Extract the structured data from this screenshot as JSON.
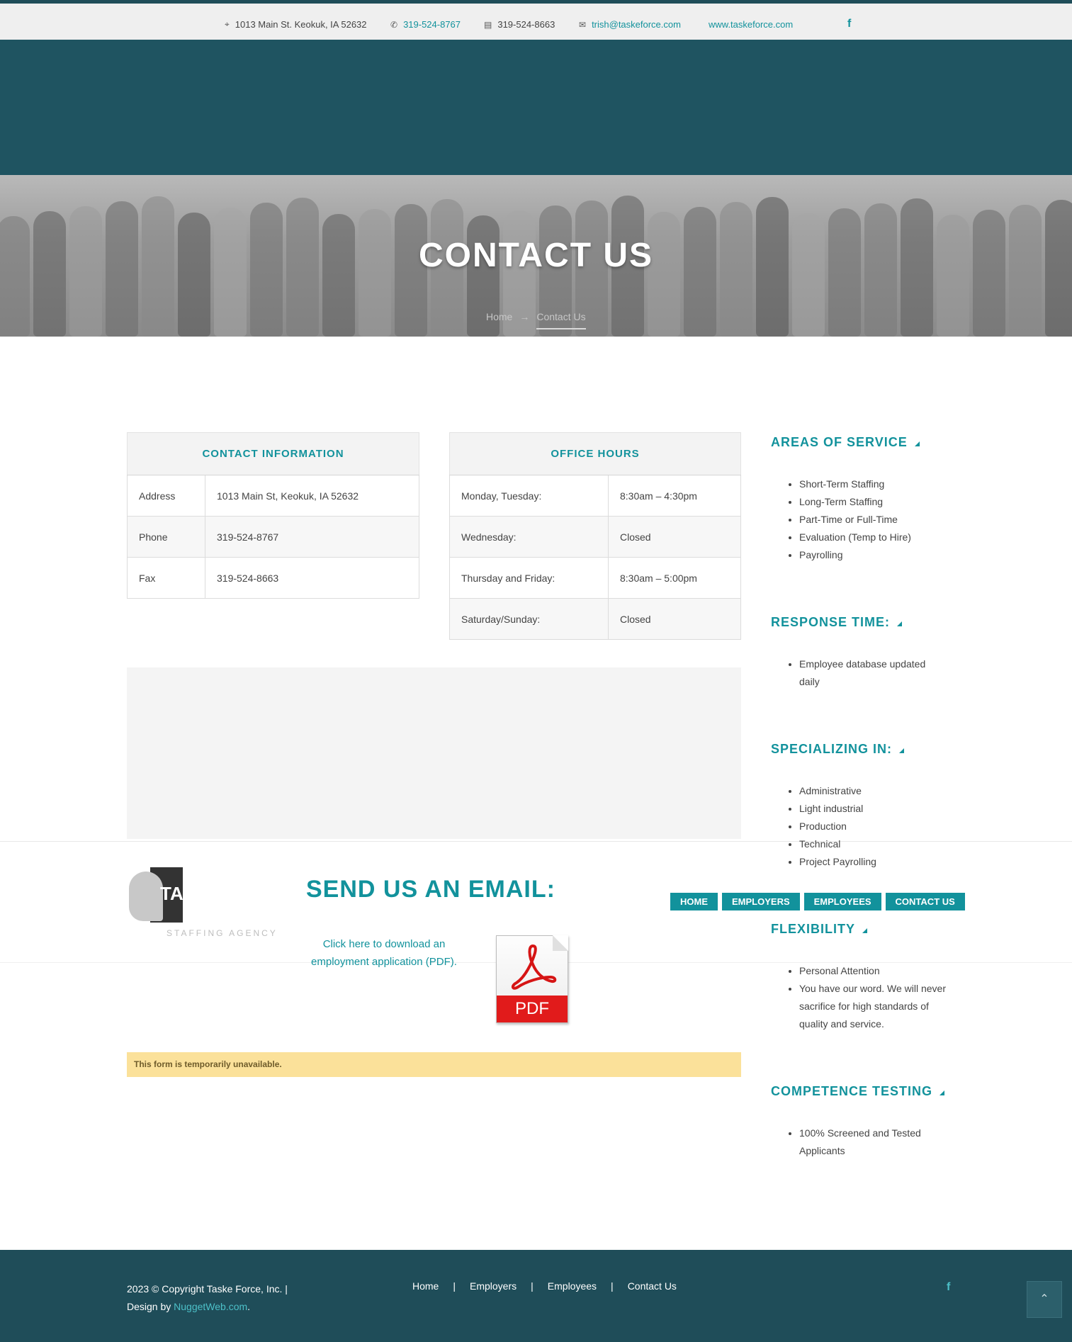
{
  "topbar": {
    "address": "1013 Main St. Keokuk, IA 52632",
    "phone": "319-524-8767",
    "fax": "319-524-8663",
    "email": "trish@taskeforce.com",
    "website": "www.taskeforce.com",
    "facebook": "f"
  },
  "hero": {
    "title": "CONTACT US",
    "breadcrumb_home": "Home",
    "breadcrumb_arrow": "→",
    "breadcrumb_current": "Contact Us"
  },
  "contact_info": {
    "heading": "CONTACT INFORMATION",
    "rows": [
      {
        "label": "Address",
        "value": "1013 Main St, Keokuk, IA 52632"
      },
      {
        "label": "Phone",
        "value": "319-524-8767"
      },
      {
        "label": "Fax",
        "value": "319-524-8663"
      }
    ]
  },
  "office_hours": {
    "heading": "OFFICE HOURS",
    "rows": [
      {
        "day": "Monday, Tuesday:",
        "hours": "8:30am – 4:30pm"
      },
      {
        "day": "Wednesday:",
        "hours": "Closed"
      },
      {
        "day": "Thursday and Friday:",
        "hours": "8:30am – 5:00pm"
      },
      {
        "day": "Saturday/Sunday:",
        "hours": "Closed"
      }
    ]
  },
  "logo": {
    "letters": "TA",
    "subtitle": "STAFFING AGENCY"
  },
  "email_section": {
    "title": "SEND US AN EMAIL:",
    "pdf_link": "Click here to download an employment application (PDF).",
    "pdf_icon_label": "PDF"
  },
  "floating_nav": [
    "HOME",
    "EMPLOYERS",
    "EMPLOYEES",
    "CONTACT US"
  ],
  "form_notice": "This form is temporarily unavailable.",
  "sidebar": {
    "areas": {
      "title": "AREAS OF SERVICE",
      "items": [
        "Short-Term Staffing",
        "Long-Term Staffing",
        "Part-Time or Full-Time",
        "Evaluation (Temp to Hire)",
        "Payrolling"
      ]
    },
    "response": {
      "title": "RESPONSE TIME:",
      "items": [
        "Employee database updated daily"
      ]
    },
    "specializing": {
      "title": "SPECIALIZING IN:",
      "items": [
        "Administrative",
        "Light industrial",
        "Production",
        "Technical",
        "Project Payrolling"
      ]
    },
    "flexibility": {
      "title": "FLEXIBILITY",
      "items": [
        "Personal Attention",
        "You have our word. We will never sacrifice for high standards of quality and service."
      ]
    },
    "competence": {
      "title": "COMPETENCE TESTING",
      "items": [
        "100% Screened and Tested Applicants"
      ]
    }
  },
  "footer": {
    "copyright": "2023 © Copyright Taske Force, Inc. |",
    "design_prefix": "Design by",
    "design_link": "NuggetWeb.com",
    "design_suffix": ".",
    "nav": [
      "Home",
      "Employers",
      "Employees",
      "Contact Us"
    ],
    "separator": "|",
    "facebook": "f",
    "to_top": "⌃"
  },
  "colors": {
    "accent": "#12929c",
    "header": "#1f5461",
    "footer": "#1f4d59",
    "notice": "#fbe19a"
  }
}
